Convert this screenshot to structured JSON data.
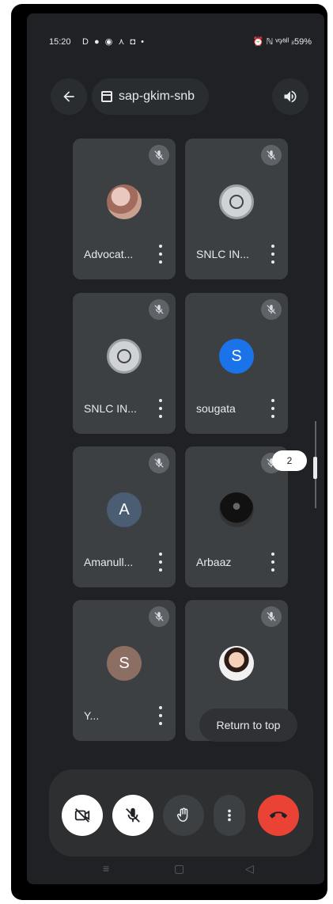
{
  "status_bar": {
    "time": "15:20",
    "icons_left": "D ● ◉ ⋏ ◘ •",
    "icons_right": "⏰ ℕ ᵛᵒ⁄ᵃˡˡ ᵢₗ",
    "battery": "59%"
  },
  "header": {
    "meeting_code": "sap-gkim-snb",
    "back_icon": "arrow-left",
    "speaker_icon": "volume"
  },
  "participants": [
    {
      "name": "Advocat...",
      "avatar_type": "photo",
      "muted": true
    },
    {
      "name": "SNLC IN...",
      "avatar_type": "emblem",
      "muted": true
    },
    {
      "name": "SNLC IN...",
      "avatar_type": "emblem",
      "muted": true
    },
    {
      "name": "sougata",
      "avatar_type": "letter",
      "letter": "S",
      "muted": true
    },
    {
      "name": "Amanull...",
      "avatar_type": "letter",
      "letter": "A",
      "muted": true
    },
    {
      "name": "Arbaaz",
      "avatar_type": "photo",
      "muted": true
    },
    {
      "name": "Y...",
      "avatar_type": "letter",
      "letter": "S",
      "muted": true
    },
    {
      "name": "",
      "avatar_type": "photo",
      "muted": true
    }
  ],
  "page_badge": "2",
  "return_to_top_label": "Return to top",
  "controls": {
    "camera": "camera-off-icon",
    "mic": "mic-off-icon",
    "hand": "raise-hand-icon",
    "more": "more-icon",
    "end": "end-call-icon"
  },
  "nav": {
    "recents": "≡",
    "home": "▢",
    "back": "◁"
  },
  "colors": {
    "background": "#202124",
    "tile": "#3c4043",
    "end_call": "#ea4335",
    "accent_blue": "#1a73e8"
  }
}
